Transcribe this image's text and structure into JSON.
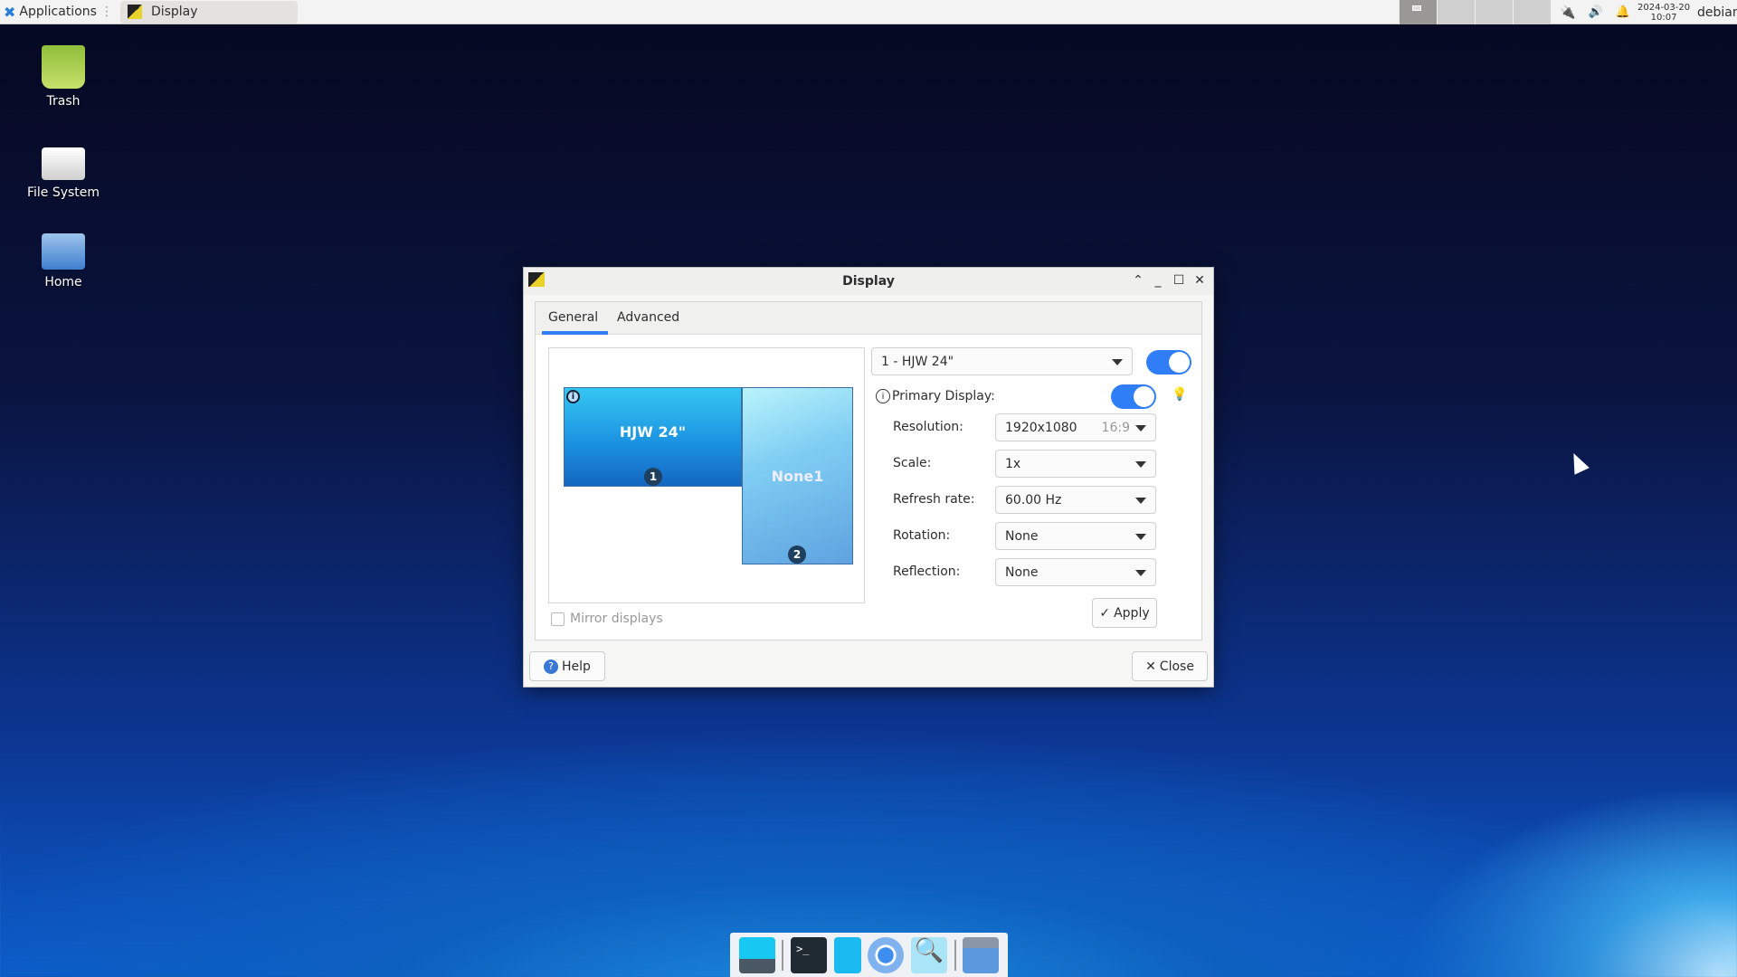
{
  "panel": {
    "applications_label": "Applications",
    "task_title": "Display",
    "date": "2024-03-20",
    "time": "10:07",
    "user": "debian"
  },
  "desktop": {
    "icons": [
      {
        "label": "Trash",
        "icon": "trash-icon"
      },
      {
        "label": "File System",
        "icon": "drive-icon"
      },
      {
        "label": "Home",
        "icon": "home-folder-icon"
      }
    ]
  },
  "dialog": {
    "title": "Display",
    "tabs": [
      {
        "label": "General",
        "active": true
      },
      {
        "label": "Advanced",
        "active": false
      }
    ],
    "monitors": [
      {
        "name": "HJW 24\"",
        "number": "1"
      },
      {
        "name": "None1",
        "number": "2"
      }
    ],
    "output_select": "1 - HJW 24\"",
    "output_enabled": true,
    "primary_label": "Primary Display:",
    "primary_enabled": true,
    "settings": [
      {
        "label": "Resolution:",
        "value": "1920x1080",
        "extra": "16:9"
      },
      {
        "label": "Scale:",
        "value": "1x"
      },
      {
        "label": "Refresh rate:",
        "value": "60.00 Hz"
      },
      {
        "label": "Rotation:",
        "value": "None"
      },
      {
        "label": "Reflection:",
        "value": "None"
      }
    ],
    "apply_label": "Apply",
    "mirror_label": "Mirror displays",
    "mirror_checked": false,
    "help_label": "Help",
    "close_label": "Close"
  },
  "taskbar": {
    "items": [
      "show-desktop-icon",
      "terminal-icon",
      "file-cabinet-icon",
      "chromium-icon",
      "app-finder-icon",
      "folder-icon"
    ]
  },
  "colors": {
    "accent": "#2f7ef5"
  }
}
